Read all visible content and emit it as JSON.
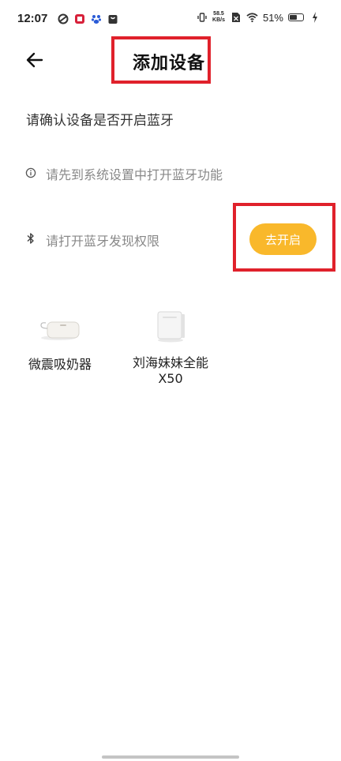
{
  "status_bar": {
    "time": "12:07",
    "net_speed_value": "58.5",
    "net_speed_unit": "KB/s",
    "battery": "51%",
    "icons": [
      "sync-icon",
      "app-badge-icon",
      "baidu-icon",
      "shopping-bag-icon",
      "vibrate-icon",
      "sim-off-icon",
      "wifi-icon",
      "battery-icon",
      "charging-icon"
    ]
  },
  "header": {
    "title": "添加设备",
    "back_icon": "arrow-left-icon"
  },
  "main": {
    "subtitle": "请确认设备是否开启蓝牙",
    "tips": [
      {
        "icon": "info-icon",
        "text": "请先到系统设置中打开蓝牙功能"
      },
      {
        "icon": "bluetooth-icon",
        "text": "请打开蓝牙发现权限"
      }
    ],
    "open_button": "去开启",
    "accent_color": "#f9b82b",
    "highlight_color": "#e0212b"
  },
  "devices": [
    {
      "name": "微震吸奶器",
      "icon": "breast-pump-icon"
    },
    {
      "name": "刘海妹妹全能X50",
      "icon": "smart-device-cube-icon"
    }
  ]
}
